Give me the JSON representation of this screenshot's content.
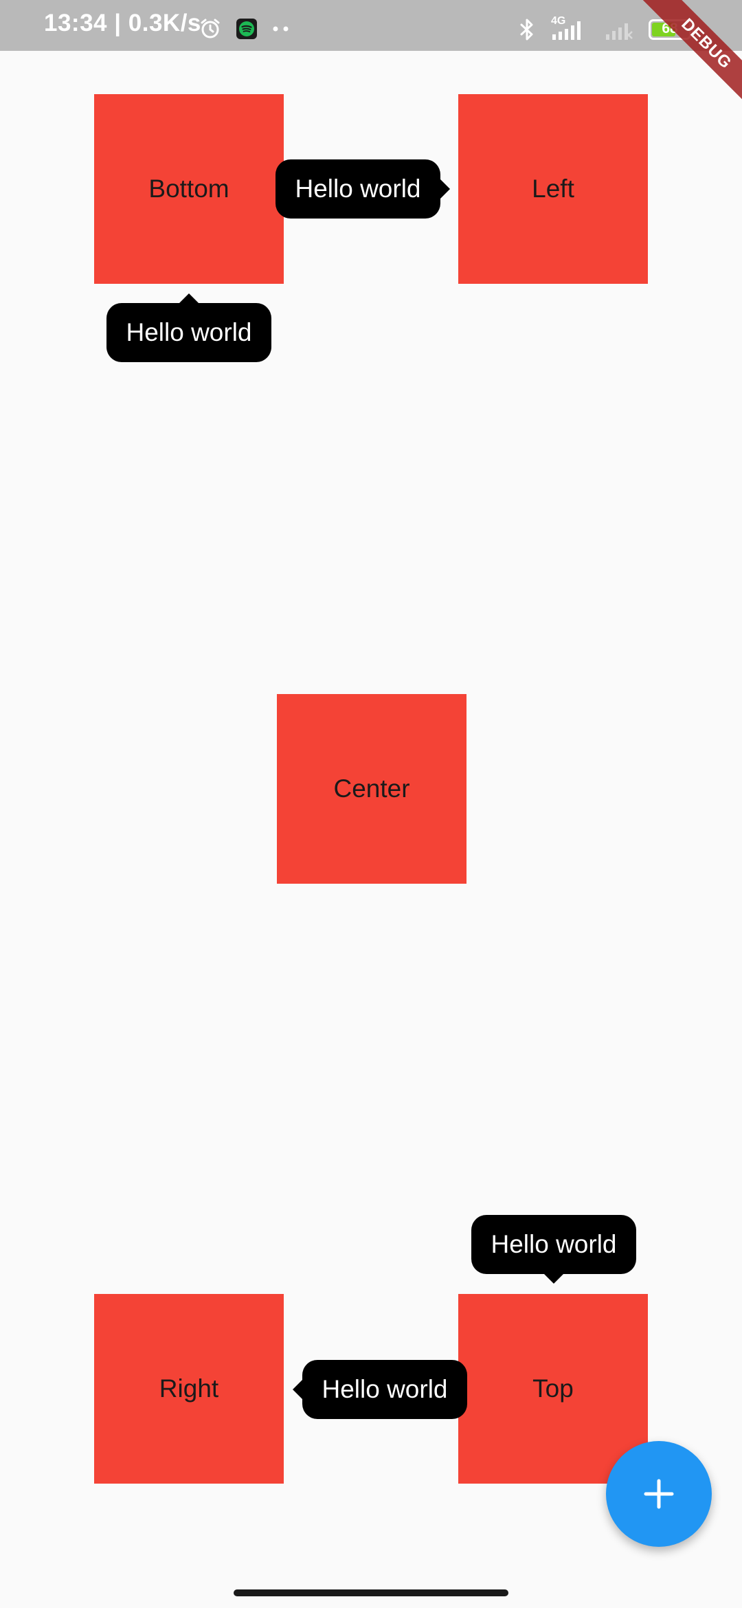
{
  "status_bar": {
    "time_speed": "13:34 | 0.3K/s",
    "icons": [
      "alarm-icon",
      "spotify-icon",
      "more-dots-icon",
      "bluetooth-icon",
      "signal-4g-icon",
      "signal-weak-icon",
      "battery-icon"
    ],
    "network_type": "4G",
    "battery_percent": "68"
  },
  "debug_banner": "DEBUG",
  "boxes": {
    "bottom": "Bottom",
    "left": "Left",
    "center": "Center",
    "right": "Right",
    "top": "Top"
  },
  "tooltips": {
    "bottom": "Hello world",
    "left": "Hello world",
    "top": "Hello world",
    "right": "Hello world"
  },
  "fab": {
    "icon": "plus-icon"
  },
  "colors": {
    "status_bar": "#B9B9B9",
    "box": "#F44336",
    "tooltip": "#000000",
    "fab": "#2196F3",
    "background": "#FAFAFA",
    "battery_fill": "#7ED321"
  }
}
